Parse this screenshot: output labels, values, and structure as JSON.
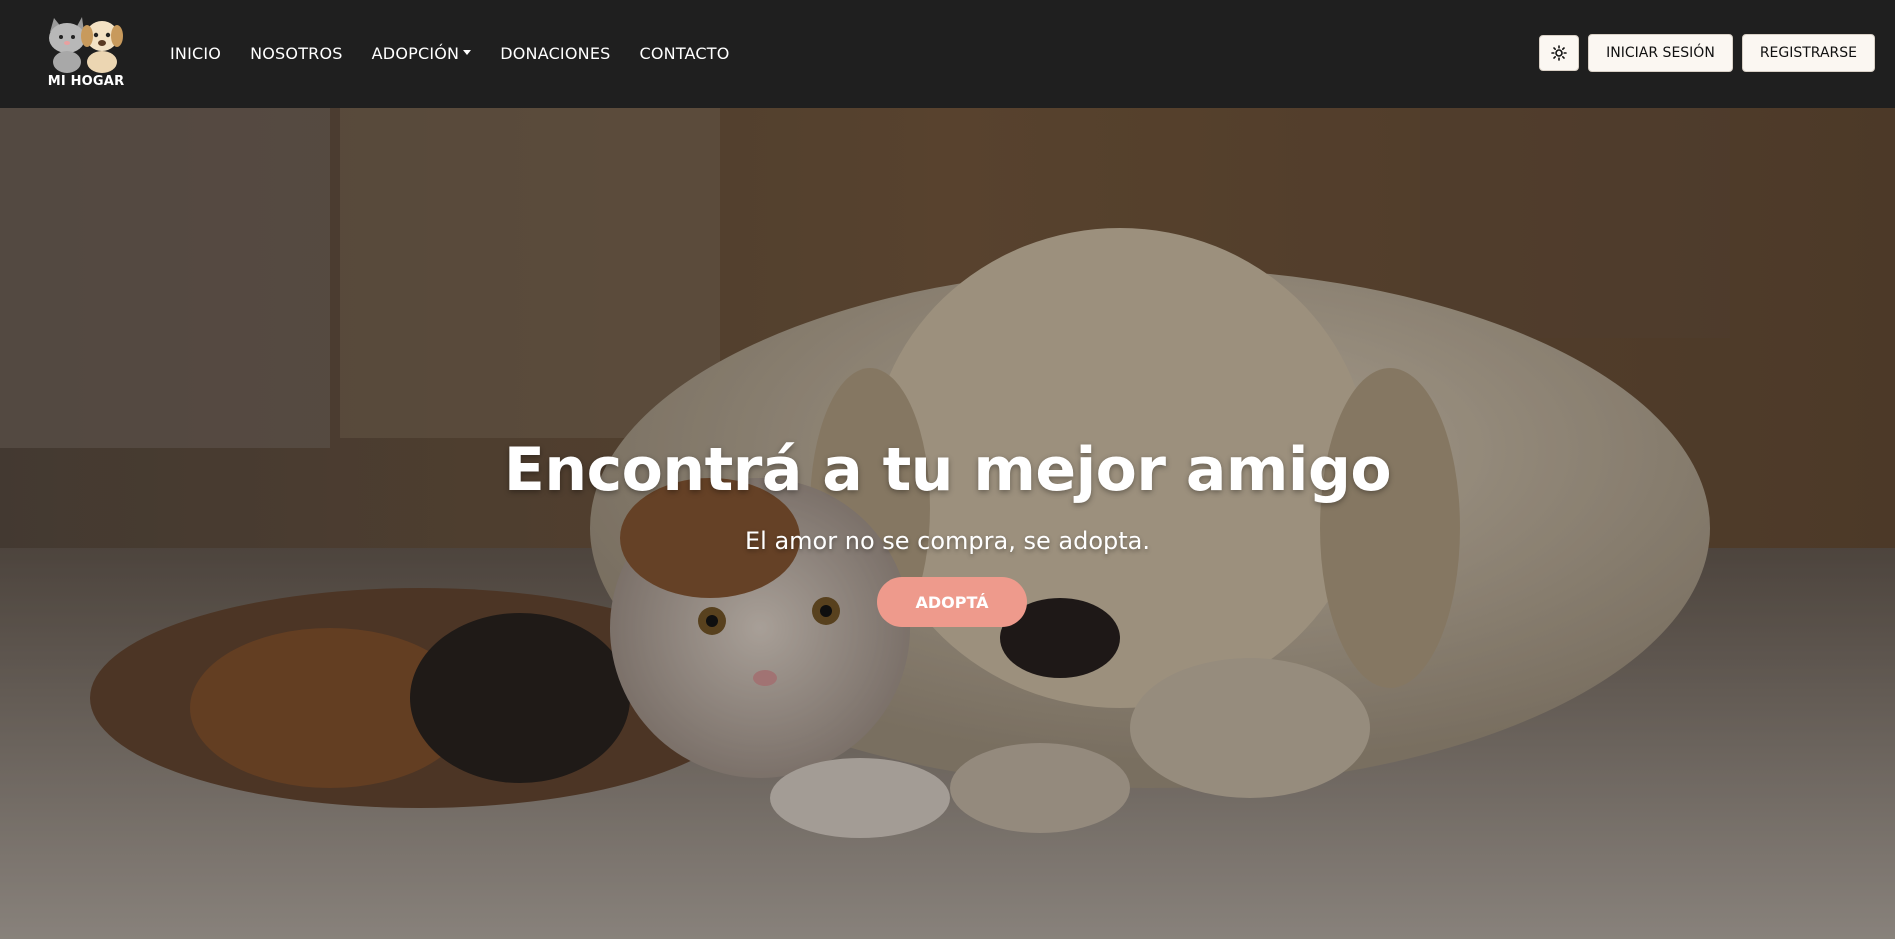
{
  "brand": {
    "name": "MI HOGAR",
    "logo_icon": "cat-and-dog-logo"
  },
  "nav": {
    "links": [
      {
        "label": "INICIO"
      },
      {
        "label": "NOSOTROS"
      },
      {
        "label": "ADOPCIÓN",
        "has_dropdown": true
      },
      {
        "label": "DONACIONES"
      },
      {
        "label": "CONTACTO"
      }
    ],
    "theme_toggle_icon": "sun-icon",
    "login_label": "INICIAR SESIÓN",
    "register_label": "REGISTRARSE"
  },
  "hero": {
    "title": "Encontrá a tu mejor amigo",
    "subtitle": "El amor no se compra, se adopta.",
    "cta_label": "ADOPTÁ",
    "background_icon": "puppy-and-kitten-photo"
  },
  "colors": {
    "navbar_bg": "#1f1f1f",
    "button_bg": "#fbf7f2",
    "cta_bg": "#ee9a8c",
    "text_light": "#ffffff"
  }
}
